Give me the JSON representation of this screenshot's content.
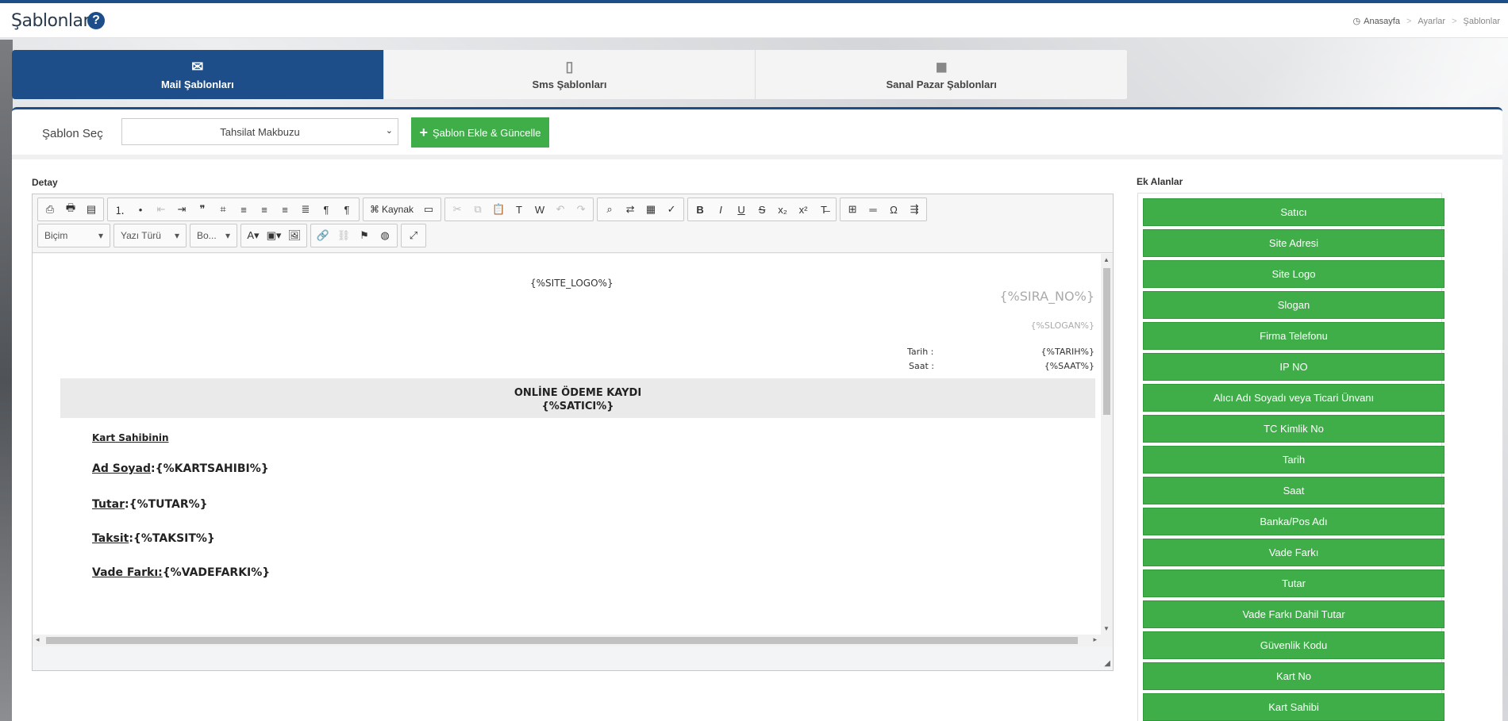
{
  "header": {
    "title": "Şablonlar",
    "help": "?",
    "breadcrumb": {
      "home": "Anasayfa",
      "sep": ">",
      "level2": "Ayarlar",
      "level3": "Şablonlar"
    }
  },
  "tabs": [
    {
      "label": "Mail Şablonları",
      "icon": "envelope-icon",
      "active": true
    },
    {
      "label": "Sms Şablonları",
      "icon": "mobile-icon",
      "active": false
    },
    {
      "label": "Sanal Pazar Şablonları",
      "icon": "shopping-bag-icon",
      "active": false
    }
  ],
  "selector": {
    "label": "Şablon Seç",
    "value": "Tahsilat Makbuzu",
    "add_button": "Şablon Ekle & Güncelle"
  },
  "editor": {
    "label": "Detay",
    "toolbar": {
      "source": "Kaynak",
      "format": "Biçim",
      "font": "Yazı Türü",
      "size": "Bo..."
    },
    "content": {
      "logo": "{%SITE_LOGO%}",
      "sira": "{%SIRA_NO%}",
      "slogan": "{%SLOGAN%}",
      "tarih_label": "Tarih :",
      "tarih_value": "{%TARIH%}",
      "saat_label": "Saat :",
      "saat_value": "{%SAAT%}",
      "banner_title": "ONLİNE ÖDEME KAYDI",
      "banner_sub": "{%SATICI%}",
      "owner_heading": "Kart Sahibinin",
      "lines": [
        {
          "key": "Ad Soyad",
          "value": ":{%KARTSAHIBI%}"
        },
        {
          "key": "Tutar",
          "value": ":{%TUTAR%}"
        },
        {
          "key": "Taksit",
          "value": ":{%TAKSIT%}"
        },
        {
          "key": "Vade Farkı:",
          "value": "{%VADEFARKI%}"
        }
      ]
    }
  },
  "extra_fields": {
    "label": "Ek Alanlar",
    "items": [
      "Satıcı",
      "Site Adresi",
      "Site Logo",
      "Slogan",
      "Firma Telefonu",
      "IP NO",
      "Alıcı Adı Soyadı veya Ticari Ünvanı",
      "TC Kimlik No",
      "Tarih",
      "Saat",
      "Banka/Pos Adı",
      "Vade Farkı",
      "Tutar",
      "Vade Farkı Dahil Tutar",
      "Güvenlik Kodu",
      "Kart No",
      "Kart Sahibi"
    ]
  },
  "colors": {
    "primary": "#1d4e89",
    "success": "#3fae49"
  }
}
